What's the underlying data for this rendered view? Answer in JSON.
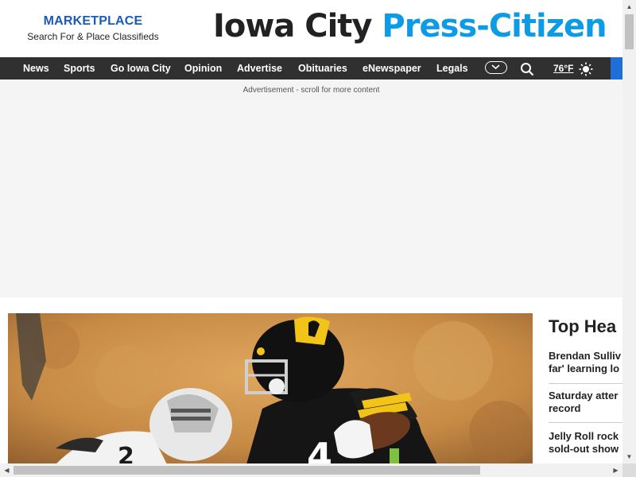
{
  "marketplace": {
    "title": "MARKETPLACE",
    "subtitle": "Search For & Place Classifieds"
  },
  "brand": {
    "part1": "Iowa City ",
    "part2": "Press-Citizen"
  },
  "nav": {
    "items": [
      {
        "label": "News"
      },
      {
        "label": "Sports"
      },
      {
        "label": "Go Iowa City"
      },
      {
        "label": "Opinion"
      },
      {
        "label": "Advertise"
      },
      {
        "label": "Obituaries"
      },
      {
        "label": "eNewspaper"
      },
      {
        "label": "Legals"
      }
    ],
    "weather": "76°F"
  },
  "ad": {
    "label": "Advertisement - scroll for more content"
  },
  "sidebar": {
    "heading": "Top Hea",
    "headlines": [
      {
        "line1": "Brendan Sulliv",
        "line2": "far' learning lo"
      },
      {
        "line1": "Saturday atter",
        "line2": "record"
      },
      {
        "line1": "Jelly Roll rock",
        "line2": "sold-out show"
      }
    ]
  },
  "hero": {
    "jersey_number": "4",
    "opponent_number": "2"
  },
  "colors": {
    "accent": "#1a5bb8",
    "brand_blue": "#0d9be6",
    "nav_bg": "#303030",
    "nav_blue": "#1e6fd9"
  },
  "icons": {
    "more": "chevron-down-icon",
    "search": "search-icon",
    "weather": "sun-icon"
  }
}
